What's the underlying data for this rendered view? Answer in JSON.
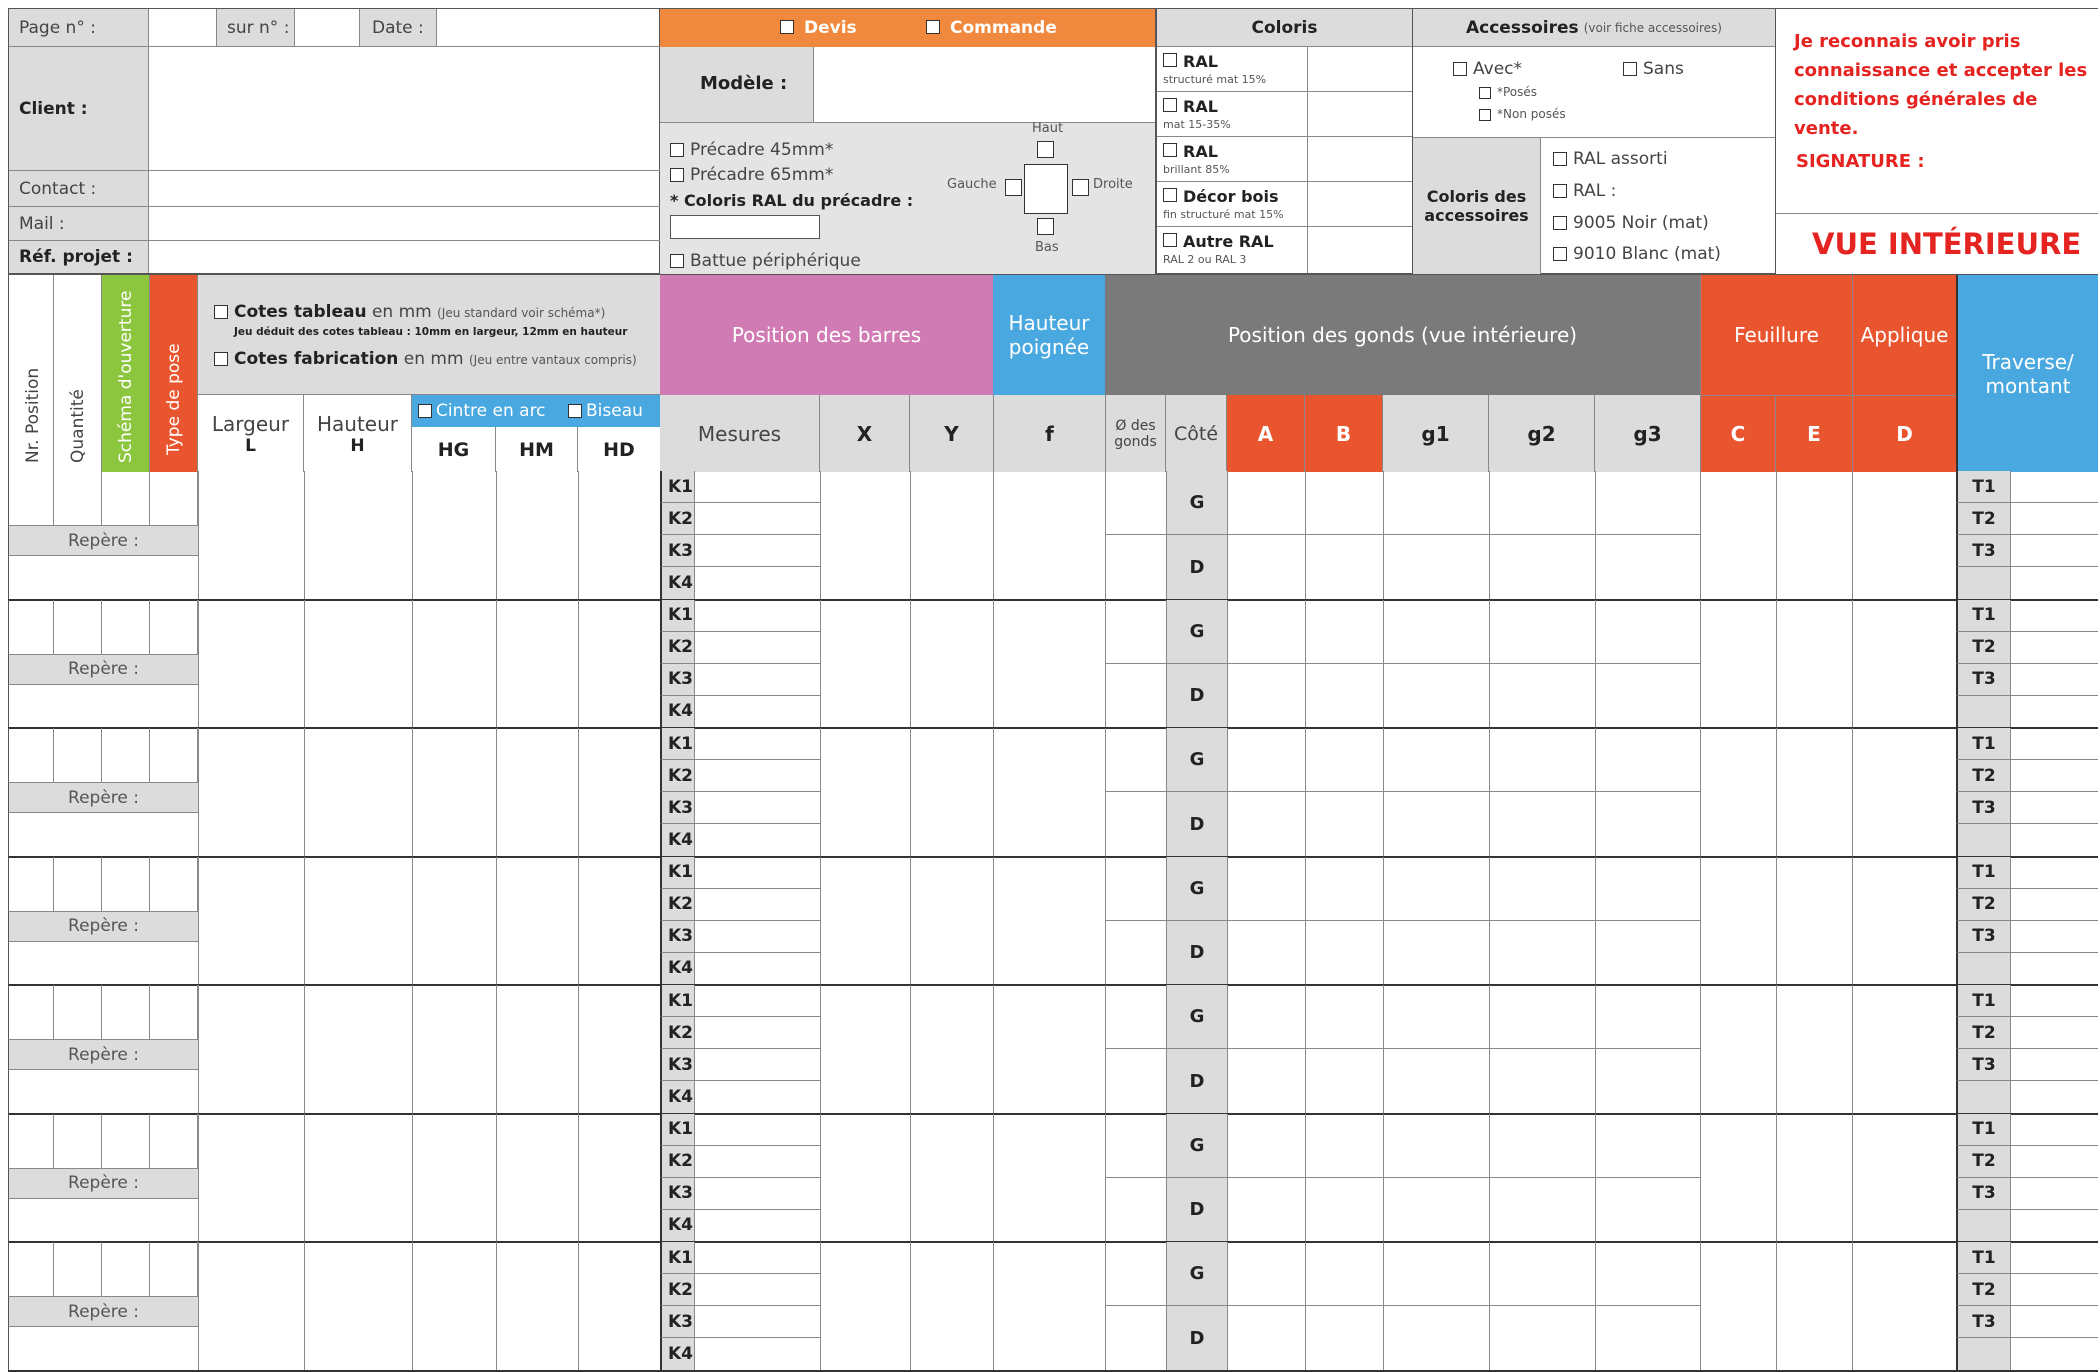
{
  "header": {
    "page_label": "Page n° :",
    "sur_label": "sur n° :",
    "date_label": "Date :",
    "client_label": "Client :",
    "contact_label": "Contact :",
    "mail_label": "Mail :",
    "ref_label": "Réf. projet :",
    "devis_label": "Devis",
    "commande_label": "Commande",
    "modele_label": "Modèle :",
    "precadre45": "Précadre 45mm*",
    "precadre65": "Précadre 65mm*",
    "coloris_precadre": "* Coloris RAL du précadre :",
    "battue": "Battue périphérique",
    "haut": "Haut",
    "bas": "Bas",
    "gauche": "Gauche",
    "droite": "Droite"
  },
  "coloris": {
    "title": "Coloris",
    "items": [
      {
        "name": "RAL",
        "sub": "structuré mat 15%"
      },
      {
        "name": "RAL",
        "sub": "mat 15-35%"
      },
      {
        "name": "RAL",
        "sub": "brillant 85%"
      },
      {
        "name": "Décor bois",
        "sub": "fin structuré mat 15%"
      },
      {
        "name": "Autre RAL",
        "sub": "RAL 2 ou RAL 3"
      }
    ]
  },
  "accessoires": {
    "title": "Accessoires",
    "title_note": "(voir fiche accessoires)",
    "avec": "Avec*",
    "sans": "Sans",
    "poses": "*Posés",
    "non_poses": "*Non posés",
    "coloris_title": "Coloris des accessoires",
    "options": [
      "RAL assorti",
      "RAL :",
      "9005 Noir (mat)",
      "9010 Blanc (mat)"
    ]
  },
  "terms": {
    "text": "Je reconnais avoir pris connaissance et accepter les conditions générales de vente.",
    "signature": "SIGNATURE :",
    "vue": "VUE INTÉRIEURE"
  },
  "columns": {
    "position": "Nr. Position",
    "quantite": "Quantité",
    "schema": "Schéma d'ouverture",
    "type_pose": "Type de pose",
    "cotes_tableau": "Cotes tableau",
    "cotes_tableau_unit": "en mm",
    "cotes_tableau_note": "(Jeu standard voir schéma*)",
    "cotes_tableau_sub": "Jeu déduit des cotes tableau : 10mm en largeur, 12mm en hauteur",
    "cotes_fab": "Cotes fabrication",
    "cotes_fab_unit": "en mm",
    "cotes_fab_note": "(Jeu entre vantaux compris)",
    "largeur": "Largeur",
    "L": "L",
    "hauteur": "Hauteur",
    "H": "H",
    "cintre": "Cintre en arc",
    "biseau": "Biseau",
    "HG": "HG",
    "HM": "HM",
    "HD": "HD",
    "pos_barres": "Position des barres",
    "mesures": "Mesures",
    "X": "X",
    "Y": "Y",
    "hauteur_poignee": "Hauteur poignée",
    "f": "f",
    "pos_gonds": "Position des gonds (vue intérieure)",
    "diam": "Ø des gonds",
    "cote": "Côté",
    "A": "A",
    "B": "B",
    "g1": "g1",
    "g2": "g2",
    "g3": "g3",
    "feuillure": "Feuillure",
    "C": "C",
    "E": "E",
    "applique": "Applique",
    "D": "D",
    "traverse": "Traverse/ montant"
  },
  "row_labels": {
    "repere": "Repère :",
    "k": [
      "K1",
      "K2",
      "K3",
      "K4"
    ],
    "g": "G",
    "d": "D",
    "t": [
      "T1",
      "T2",
      "T3"
    ]
  },
  "colors": {
    "orange": "#f0883e",
    "pink": "#d17bb5",
    "blue": "#4aa8e0",
    "green": "#8cc63f",
    "red": "#e9552f",
    "grey": "#7a7a7a",
    "text_red": "#e52421"
  }
}
